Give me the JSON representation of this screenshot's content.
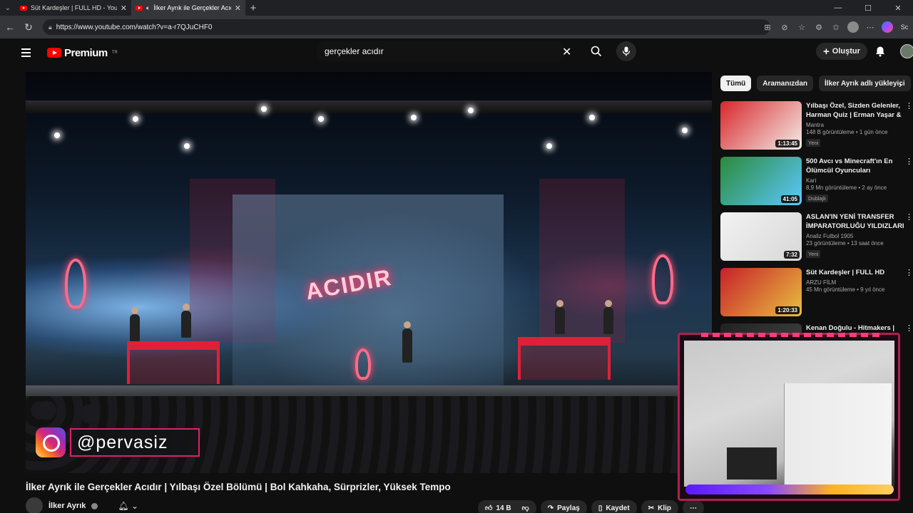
{
  "browser": {
    "tabs": [
      {
        "title": "Süt Kardeşler | FULL HD - YouTube"
      },
      {
        "title": "İlker Ayrık ile Gerçekler Acıdır"
      }
    ],
    "url": "https://www.youtube.com/watch?v=a-r7QJuCHF0",
    "copilot_label": "Sc"
  },
  "header": {
    "logo_text": "Premium",
    "logo_region": "TR",
    "search_value": "gerçekler acıdır",
    "create_label": "Oluştur"
  },
  "video": {
    "overlay_handle": "@pervasiz",
    "title": "İlker Ayrık ile Gerçekler Acıdır | Yılbaşı Özel Bölümü | Bol Kahkaha, Sürprizler, Yüksek Tempo",
    "channel": "İlker Ayrık",
    "likes": "14 B",
    "share_label": "Paylaş",
    "save_label": "Kaydet",
    "clip_label": "Klip"
  },
  "chips": [
    {
      "label": "Tümü",
      "active": true
    },
    {
      "label": "Aramanızdan",
      "active": false
    },
    {
      "label": "İlker Ayrık adlı yükleyici",
      "active": false
    }
  ],
  "recommendations": [
    {
      "title": "Yılbaşı Özel, Sizden Gelenler, Harman Quiz | Erman Yaşar & ...",
      "channel": "Mantra",
      "meta": "148 B görüntüleme • 1 gün önce",
      "badge": "Yeni",
      "duration": "1:13:45",
      "colors": [
        "#d8262c",
        "#f3efe8"
      ]
    },
    {
      "title": "500 Avcı vs Minecraft'ın En Ölümcül Oyuncuları",
      "channel": "Kari",
      "meta": "8,9 Mn görüntüleme • 2 ay önce",
      "badge": "Dublajlı",
      "duration": "41:05",
      "colors": [
        "#2a8a3a",
        "#5cc8ff"
      ]
    },
    {
      "title": "ASLAN'IN YENİ TRANSFER İMPARATORLUĞU YILDIZLARI",
      "channel": "Analiz Futbol 1905",
      "meta": "23 görüntüleme • 13 saat önce",
      "badge": "Yeni",
      "duration": "7:32",
      "colors": [
        "#f2f2f2",
        "#d8d8d8"
      ]
    },
    {
      "title": "Süt Kardeşler | FULL HD",
      "channel": "ARZU FİLM",
      "meta": "45 Mn görüntüleme • 9 yıl önce",
      "badge": "",
      "duration": "1:20:33",
      "colors": [
        "#c8202a",
        "#e8c040"
      ]
    },
    {
      "title": "Kenan Doğulu - Hitmakers | Arem & Arman",
      "channel": "",
      "meta": "",
      "badge": "",
      "duration": "",
      "colors": [
        "#222",
        "#444"
      ]
    }
  ]
}
